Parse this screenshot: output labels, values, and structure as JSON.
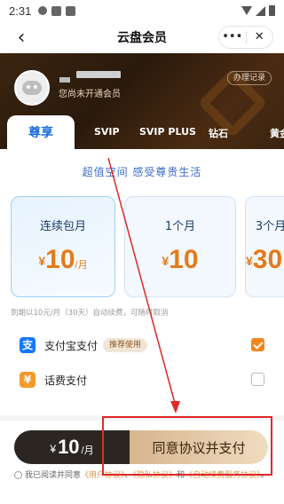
{
  "status_bar": {
    "time": "2:31"
  },
  "nav": {
    "back_icon": "‹",
    "title": "云盘会员",
    "more_label": "•••",
    "close_label": "✕"
  },
  "profile": {
    "status": "您尚未开通会员",
    "records_label": "办理记录"
  },
  "tabs": [
    {
      "label": "尊享",
      "active": true
    },
    {
      "label": "SVIP"
    },
    {
      "label": "SVIP PLUS"
    },
    {
      "label": "钻石"
    },
    {
      "label": "黄金"
    }
  ],
  "subtitle": "超值空间 感受尊贵生活",
  "plans": [
    {
      "name": "连续包月",
      "currency": "¥",
      "price": "10",
      "unit": "/月",
      "selected": true
    },
    {
      "name": "1个月",
      "currency": "¥",
      "price": "10",
      "unit": ""
    },
    {
      "name": "3个月",
      "currency": "¥",
      "price": "30",
      "unit": ""
    }
  ],
  "auto_renew_note": "到期以10元/月（30天）自动续费，可随时取消",
  "payment_methods": [
    {
      "label": "支付宝支付",
      "icon": "alipay-icon",
      "icon_glyph": "支",
      "icon_color": "#1677ff",
      "tag": "推荐使用",
      "checked": true
    },
    {
      "label": "话费支付",
      "icon": "phone-bill-icon",
      "icon_glyph": "¥",
      "icon_color": "#f39a2c",
      "checked": false
    }
  ],
  "paybar": {
    "currency": "¥",
    "amount": "10",
    "unit": "/月",
    "cta_label": "同意协议并支付"
  },
  "agreement": {
    "prefix": "我已阅读并同意",
    "link1": "《用户协议》",
    "sep1": "、",
    "link2": "《隐私协议》",
    "sep2": "和",
    "link3": "《自动续费服务协议》",
    "suffix": "。"
  },
  "colors": {
    "accent_blue": "#1d6bd8",
    "price_orange": "#e57a1a",
    "annotation_red": "#e02828"
  }
}
